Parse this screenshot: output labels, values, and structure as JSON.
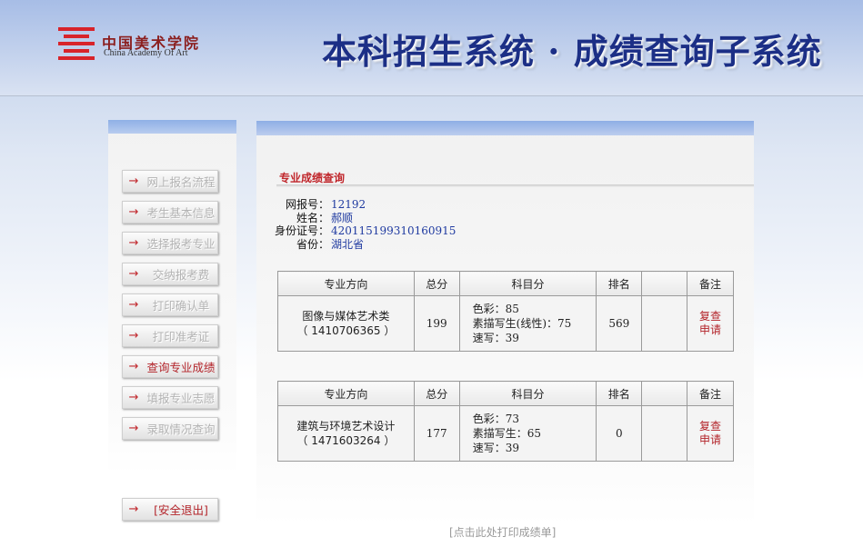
{
  "header": {
    "logo_cn": "中国美术学院",
    "logo_en": "China Academy Of Art",
    "system_title": "本科招生系统 · 成绩查询子系统"
  },
  "nav": {
    "arrow": "→",
    "items": [
      {
        "label": "网上报名流程"
      },
      {
        "label": "考生基本信息"
      },
      {
        "label": "选择报考专业"
      },
      {
        "label": "交纳报考费"
      },
      {
        "label": "打印确认单"
      },
      {
        "label": "打印准考证"
      },
      {
        "label": "查询专业成绩"
      },
      {
        "label": "填报专业志愿"
      },
      {
        "label": "录取情况查询"
      }
    ],
    "logout": "[安全退出]"
  },
  "main": {
    "section_title": "专业成绩查询",
    "info": {
      "reg_no_label": "网报号：",
      "reg_no": "12192",
      "name_label": "姓名：",
      "name": "郝顺",
      "id_label": "身份证号：",
      "id_no": "420115199310160915",
      "province_label": "省份：",
      "province": "湖北省"
    },
    "table_headers": {
      "direction": "专业方向",
      "total": "总分",
      "subjects": "科目分",
      "rank": "排名",
      "blank": "",
      "remark": "备注"
    },
    "results": [
      {
        "direction": "图像与媒体艺术类",
        "code": "（ 1410706365 ）",
        "total": "199",
        "subjects": [
          "色彩：85",
          "素描写生(线性)：75",
          "速写：39"
        ],
        "rank": "569",
        "remark_line1": "复查",
        "remark_line2": "申请"
      },
      {
        "direction": "建筑与环境艺术设计",
        "code": "（ 1471603264 ）",
        "total": "177",
        "subjects": [
          "色彩：73",
          "素描写生：65",
          "速写：39"
        ],
        "rank": "0",
        "remark_line1": "复查",
        "remark_line2": "申请"
      }
    ],
    "print_link": "[点击此处打印成绩单]"
  },
  "colors": {
    "accent_red": "#c0262b",
    "title_blue": "#1c2f86",
    "value_blue": "#1f3aa0"
  }
}
